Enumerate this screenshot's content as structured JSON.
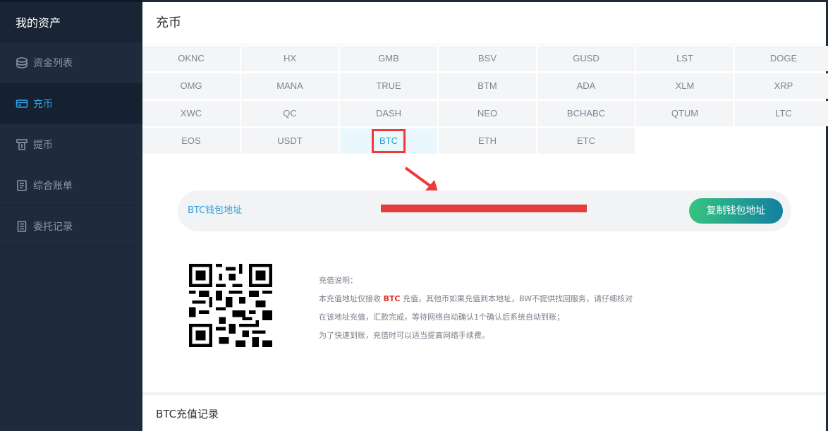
{
  "sidebar": {
    "title": "我的资产",
    "items": [
      {
        "label": "资金列表",
        "icon": "coins-icon"
      },
      {
        "label": "充币",
        "icon": "card-icon",
        "active": true
      },
      {
        "label": "提币",
        "icon": "withdraw-icon"
      },
      {
        "label": "综合账单",
        "icon": "bill-icon"
      },
      {
        "label": "委托记录",
        "icon": "record-icon"
      }
    ]
  },
  "page": {
    "title": "充币"
  },
  "coins": [
    "OKNC",
    "HX",
    "GMB",
    "BSV",
    "GUSD",
    "LST",
    "DOGE",
    "OMG",
    "MANA",
    "TRUE",
    "BTM",
    "ADA",
    "XLM",
    "XRP",
    "XWC",
    "QC",
    "DASH",
    "NEO",
    "BCHABC",
    "QTUM",
    "LTC",
    "EOS",
    "USDT",
    "BTC",
    "ETH",
    "ETC"
  ],
  "selected_coin": "BTC",
  "address": {
    "label": "BTC钱包地址",
    "copy_button": "复制钱包地址"
  },
  "notes": {
    "title": "充值说明：",
    "line1_prefix": "本充值地址仅接收",
    "line1_coin": "BTC",
    "line1_suffix": "充值，其他币如果充值到本地址，BW不提供找回服务，请仔细核对",
    "line2": "在该地址充值，汇款完成，等待网络自动确认1个确认后系统自动到账；",
    "line3": "为了快速到账，充值时可以适当提高网络手续费。"
  },
  "history": {
    "title": "BTC充值记录"
  },
  "colors": {
    "accent": "#2fa6e8",
    "highlight_red": "#e0312c",
    "button_start": "#36c480",
    "button_end": "#137fa2"
  }
}
